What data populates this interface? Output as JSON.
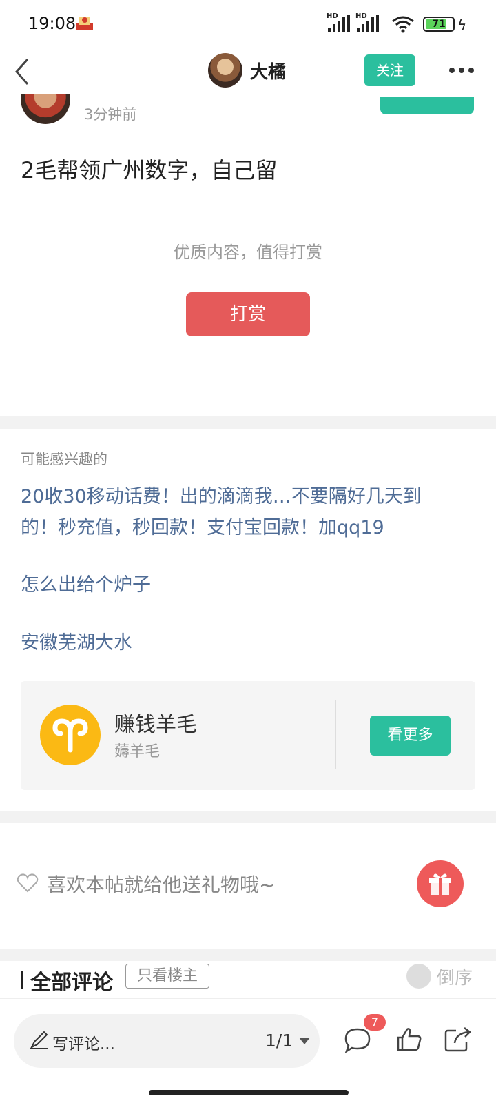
{
  "status_bar": {
    "time": "19:08",
    "signal_1_label": "HD",
    "signal_2_label": "HD",
    "battery_level": "71"
  },
  "header": {
    "author_name": "大橘",
    "follow_label": "关注"
  },
  "post": {
    "time_ago": "3分钟前",
    "body": "2毛帮领广州数字，自己留",
    "reward_hint": "优质内容，值得打赏",
    "reward_label": "打赏"
  },
  "related": {
    "title": "可能感兴趣的",
    "items": [
      {
        "line1": "20收30移动话费！出的滴滴我…不要隔好几天到",
        "line2": "的！秒充值，秒回款！支付宝回款！加qq19"
      },
      {
        "line1": "怎么出给个炉子"
      },
      {
        "line1": "安徽芜湖大水"
      }
    ]
  },
  "forum_card": {
    "name": "赚钱羊毛",
    "subtitle": "薅羊毛",
    "see_more_label": "看更多"
  },
  "gift": {
    "prompt": "喜欢本帖就给他送礼物哦~"
  },
  "comments": {
    "title": "全部评论",
    "op_only_label": "只看楼主",
    "sort_label": "倒序"
  },
  "bottom_bar": {
    "write_comment_placeholder": "写评论...",
    "page_indicator": "1/1",
    "comment_count": "7"
  },
  "colors": {
    "accent_green": "#2bbf9e",
    "reward_red": "#e55a5a",
    "link_blue": "#4f6c96"
  }
}
